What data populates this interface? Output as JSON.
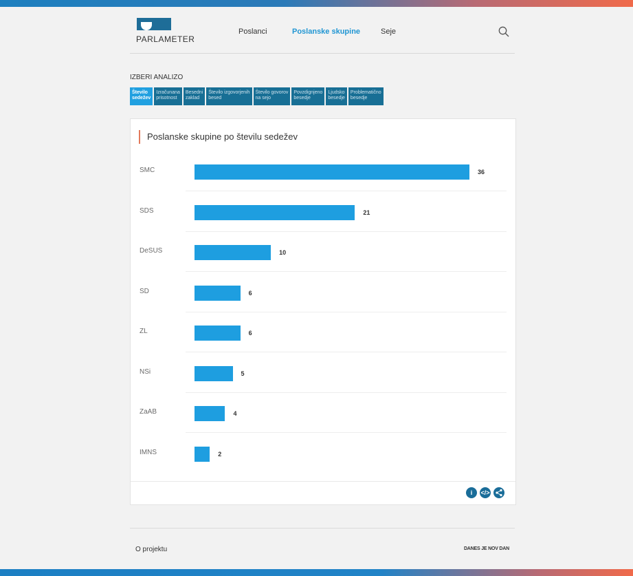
{
  "header": {
    "logo_text": "PARLAMETER",
    "nav": [
      "Poslanci",
      "Poslanske skupine",
      "Seje"
    ],
    "active_nav": "Poslanske skupine"
  },
  "analysis": {
    "title": "IZBERI ANALIZO",
    "tabs": [
      {
        "line1": "Število",
        "line2": "sedežev",
        "active": true
      },
      {
        "line1": "Izračunana",
        "line2": "prisotnost",
        "active": false
      },
      {
        "line1": "Besedni",
        "line2": "zaklad",
        "active": false
      },
      {
        "line1": "Število izgovorjenih",
        "line2": "besed",
        "active": false
      },
      {
        "line1": "Število govorov",
        "line2": "na sejo",
        "active": false
      },
      {
        "line1": "Povzdignjeno",
        "line2": "besedje",
        "active": false
      },
      {
        "line1": "Ljudsko",
        "line2": "besedje",
        "active": false
      },
      {
        "line1": "Problematično",
        "line2": "besedje",
        "active": false
      }
    ]
  },
  "card": {
    "title": "Poslanske skupine po številu sedežev",
    "actions": [
      "info-icon",
      "embed-icon",
      "share-icon"
    ]
  },
  "chart_data": {
    "type": "bar",
    "orientation": "horizontal",
    "title": "Poslanske skupine po številu sedežev",
    "categories": [
      "SMC",
      "SDS",
      "DeSUS",
      "SD",
      "ZL",
      "NSi",
      "ZaAB",
      "IMNS"
    ],
    "values": [
      36,
      21,
      10,
      6,
      6,
      5,
      4,
      2
    ],
    "color": "#1e9ee0",
    "xlim": [
      0,
      36
    ]
  },
  "footer": {
    "link": "O projektu",
    "brand": "DANES JE NOV DAN"
  },
  "colors": {
    "accent": "#2196d3",
    "tab_bg": "#186f95",
    "tab_active": "#21a0e0",
    "bar": "#1e9ee0",
    "title_accent": "#e37a5c"
  }
}
